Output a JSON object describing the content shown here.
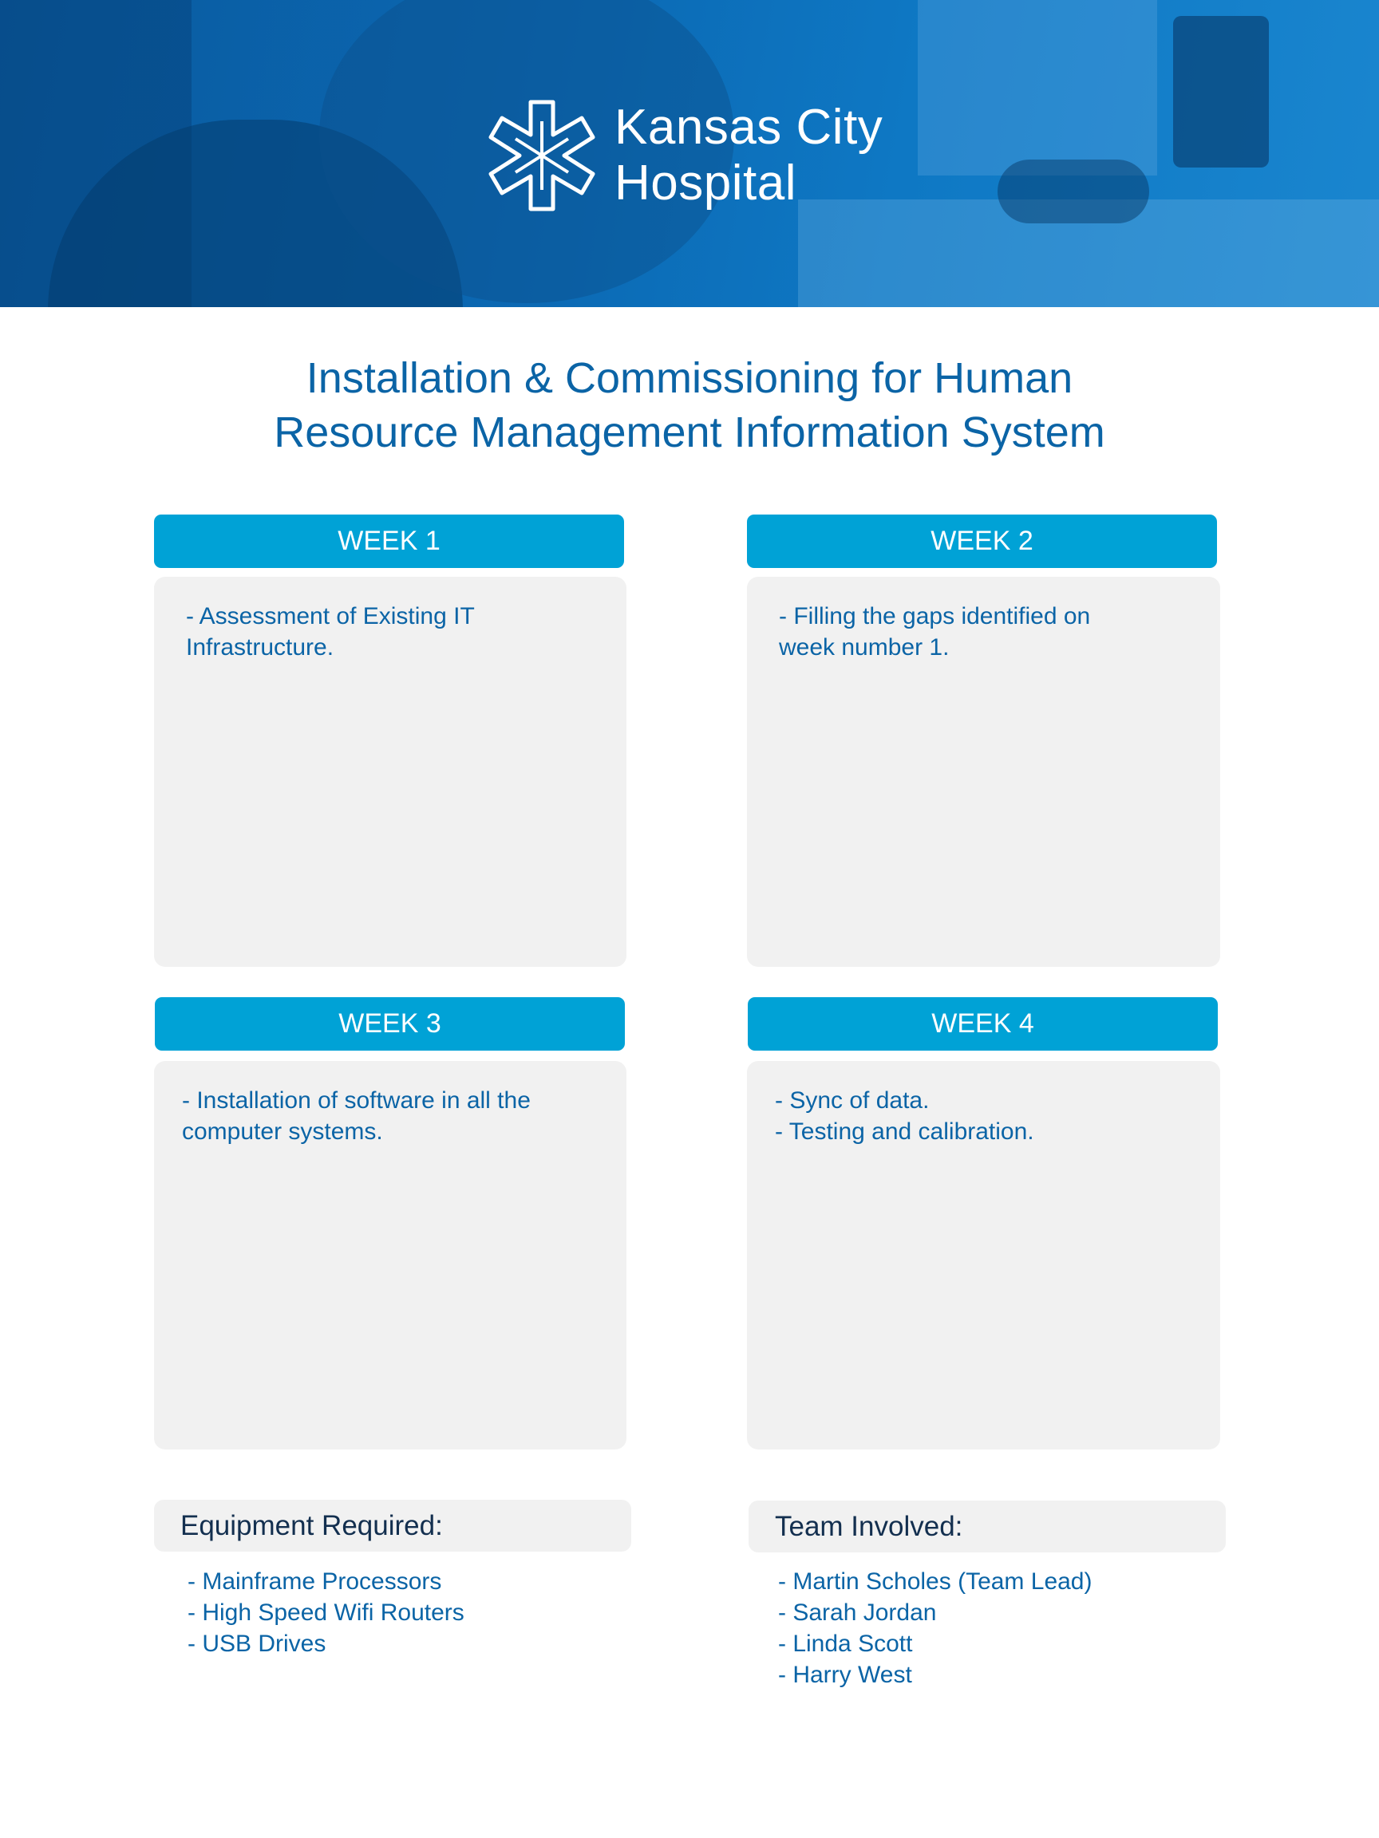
{
  "header": {
    "hospital_name_line1": "Kansas City",
    "hospital_name_line2": "Hospital",
    "logo_icon": "star-of-life-icon"
  },
  "title": {
    "line1": "Installation & Commissioning for Human",
    "line2": "Resource Management Information System"
  },
  "weeks": [
    {
      "label": "WEEK 1",
      "items": [
        "- Assessment of Existing IT",
        "Infrastructure."
      ]
    },
    {
      "label": "WEEK 2",
      "items": [
        "- Filling the gaps identified on",
        "week number 1."
      ]
    },
    {
      "label": "WEEK 3",
      "items": [
        "- Installation of software in all the",
        "computer systems."
      ]
    },
    {
      "label": "WEEK 4",
      "items": [
        "- Sync of data.",
        "- Testing and calibration."
      ]
    }
  ],
  "equipment": {
    "heading": "Equipment Required:",
    "items": [
      "- Mainframe Processors",
      "- High Speed Wifi Routers",
      "- USB Drives"
    ]
  },
  "team": {
    "heading": "Team Involved:",
    "items": [
      "- Martin Scholes (Team Lead)",
      "- Sarah Jordan",
      "- Linda Scott",
      "- Harry West"
    ]
  },
  "colors": {
    "accent_blue": "#00a2d6",
    "text_blue": "#0b64a6",
    "panel_gray": "#f1f1f1",
    "heading_dark": "#132f4f"
  }
}
